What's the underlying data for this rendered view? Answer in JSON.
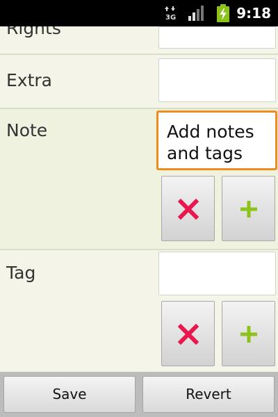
{
  "status_bar": {
    "time": "9:18",
    "network_type": "3G",
    "icons": [
      "network-3g-icon",
      "signal-strength-icon",
      "battery-charging-icon"
    ]
  },
  "form": {
    "rows": [
      {
        "label": "Rights",
        "value": ""
      },
      {
        "label": "Extra",
        "value": ""
      },
      {
        "label": "Note",
        "value": "Add notes\nand tags",
        "focused": true
      },
      {
        "label": "Tag",
        "value": ""
      }
    ],
    "remove_icon": "delete-x-icon",
    "add_icon": "plus-icon"
  },
  "buttons": {
    "save": "Save",
    "revert": "Revert"
  },
  "colors": {
    "background": "#f4f5e8",
    "focus_border": "#f08c1b",
    "remove": "#e8174e",
    "add": "#8cc21a"
  }
}
